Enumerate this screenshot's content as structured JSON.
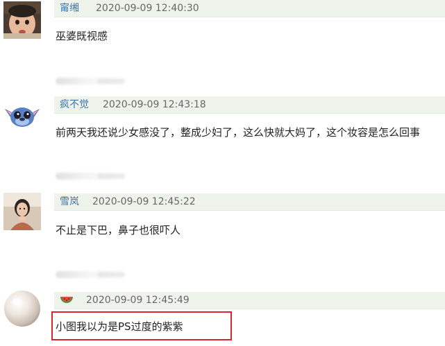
{
  "comments": [
    {
      "username": "甯缃",
      "timestamp": "2020-09-09 12:40:30",
      "text": "巫婆既视感",
      "avatar": "baby-photo-avatar"
    },
    {
      "username": "疯不觉",
      "timestamp": "2020-09-09 12:43:18",
      "text": "前两天我还说少女感没了，整成少妇了，这么快就大妈了，这个妆容是怎么回事",
      "avatar": "stitch-cartoon-avatar"
    },
    {
      "username": "雪岚",
      "timestamp": "2020-09-09 12:45:22",
      "text": "不止是下巴，鼻子也很吓人",
      "avatar": "woman-photo-avatar"
    },
    {
      "username": "",
      "timestamp": "2020-09-09 12:45:49",
      "text": "小图我以为是PS过度的紫紫",
      "avatar": "pearl-avatar",
      "username_icon": "watermelon-icon"
    }
  ],
  "colors": {
    "meta_bar_bg": "#eef4ec",
    "username": "#3e73a8",
    "highlight_border": "#d9262b"
  }
}
